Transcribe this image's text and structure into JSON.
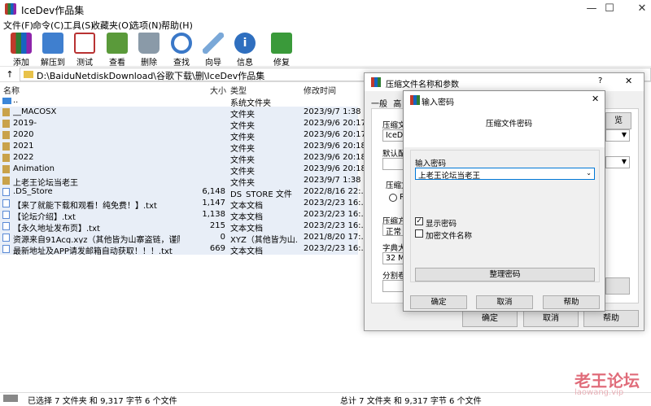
{
  "window": {
    "title": "IceDev作品集",
    "minimize": "—",
    "maximize": "☐",
    "close": "✕"
  },
  "menu": [
    "文件(F)",
    "命令(C)",
    "工具(S)",
    "收藏夹(O)",
    "选项(N)",
    "帮助(H)"
  ],
  "toolbar": [
    {
      "label": "添加",
      "icon": "books-add-icon",
      "color": "#c0392b"
    },
    {
      "label": "解压到",
      "icon": "folder-extract-icon",
      "color": "#3f7fcf"
    },
    {
      "label": "测试",
      "icon": "test-checklist-icon",
      "color": "#b83232"
    },
    {
      "label": "查看",
      "icon": "book-view-icon",
      "color": "#5a9a3a"
    },
    {
      "label": "删除",
      "icon": "trash-icon",
      "color": "#8a9aa8"
    },
    {
      "label": "查找",
      "icon": "magnifier-icon",
      "color": "#3a78c8"
    },
    {
      "label": "向导",
      "icon": "wand-icon",
      "color": "#7aa8d8"
    },
    {
      "label": "信息",
      "icon": "info-icon",
      "color": "#2f6fbf"
    },
    {
      "label": "修复",
      "icon": "repair-book-icon",
      "color": "#3a9a3a"
    }
  ],
  "address": {
    "path": "D:\\BaiduNetdiskDownload\\谷歌下载\\删\\IceDev作品集",
    "up": "↑"
  },
  "columns": {
    "name": "名称",
    "size": "大小",
    "type": "类型",
    "modified": "修改时间"
  },
  "files": [
    {
      "name": "..",
      "size": "",
      "type": "系统文件夹",
      "modified": "",
      "kind": "up"
    },
    {
      "name": "__MACOSX",
      "size": "",
      "type": "文件夹",
      "modified": "2023/9/7 1:38",
      "kind": "folder"
    },
    {
      "name": "2019-",
      "size": "",
      "type": "文件夹",
      "modified": "2023/9/6 20:17",
      "kind": "folder"
    },
    {
      "name": "2020",
      "size": "",
      "type": "文件夹",
      "modified": "2023/9/6 20:17",
      "kind": "folder"
    },
    {
      "name": "2021",
      "size": "",
      "type": "文件夹",
      "modified": "2023/9/6 20:18",
      "kind": "folder"
    },
    {
      "name": "2022",
      "size": "",
      "type": "文件夹",
      "modified": "2023/9/6 20:18",
      "kind": "folder"
    },
    {
      "name": "Animation",
      "size": "",
      "type": "文件夹",
      "modified": "2023/9/6 20:18",
      "kind": "folder"
    },
    {
      "name": "上老王论坛当老王",
      "size": "",
      "type": "文件夹",
      "modified": "2023/9/7 1:38",
      "kind": "folder"
    },
    {
      "name": ".DS_Store",
      "size": "6,148",
      "type": "DS_STORE 文件",
      "modified": "2022/8/16 22:...",
      "kind": "file"
    },
    {
      "name": "【来了就能下载和观看！纯免费！】.txt",
      "size": "1,147",
      "type": "文本文档",
      "modified": "2023/2/23 16:...",
      "kind": "file"
    },
    {
      "name": "【论坛介绍】.txt",
      "size": "1,138",
      "type": "文本文档",
      "modified": "2023/2/23 16:...",
      "kind": "file"
    },
    {
      "name": "【永久地址发布页】.txt",
      "size": "215",
      "type": "文本文档",
      "modified": "2023/2/23 16:...",
      "kind": "file"
    },
    {
      "name": "资源来自91Acg.xyz（其他皆为山寨盗链，谨防被...",
      "size": "0",
      "type": "XYZ（其他皆为山...",
      "modified": "2021/8/20 17:...",
      "kind": "file"
    },
    {
      "name": "最新地址及APP请发邮箱自动获取！！！.txt",
      "size": "669",
      "type": "文本文档",
      "modified": "2023/2/23 16:...",
      "kind": "file"
    }
  ],
  "status": {
    "left": "已选择 7 文件夹 和 9,317 字节 6 个文件",
    "right": "总计 7 文件夹 和 9,317 字节 6 个文件"
  },
  "archive_dialog": {
    "title": "压缩文件名称和参数",
    "help": "?",
    "close": "✕",
    "tabs": [
      "一般",
      "高"
    ],
    "filename_label": "压缩文",
    "filename_value": "IceDev",
    "browse": "览",
    "profile_label": "默认配",
    "format_label": "压缩文",
    "format_option": "RA",
    "method_label": "压缩方",
    "method_value": "正常",
    "dict_label": "字典大小",
    "dict_value": "32 MB",
    "split_label": "分割卷,",
    "ok": "确定",
    "cancel": "取消",
    "help_btn": "帮助"
  },
  "password_dialog": {
    "title": "输入密码",
    "close": "✕",
    "header": "压缩文件密码",
    "input_label": "输入密码",
    "password": "上老王论坛当老王",
    "show_password": "显示密码",
    "show_checked": "✓",
    "encrypt_names": "加密文件名称",
    "organize": "整理密码",
    "ok": "确定",
    "cancel": "取消",
    "help": "帮助"
  },
  "watermark": {
    "text": "老王论坛",
    "url": "laowang.vip"
  }
}
